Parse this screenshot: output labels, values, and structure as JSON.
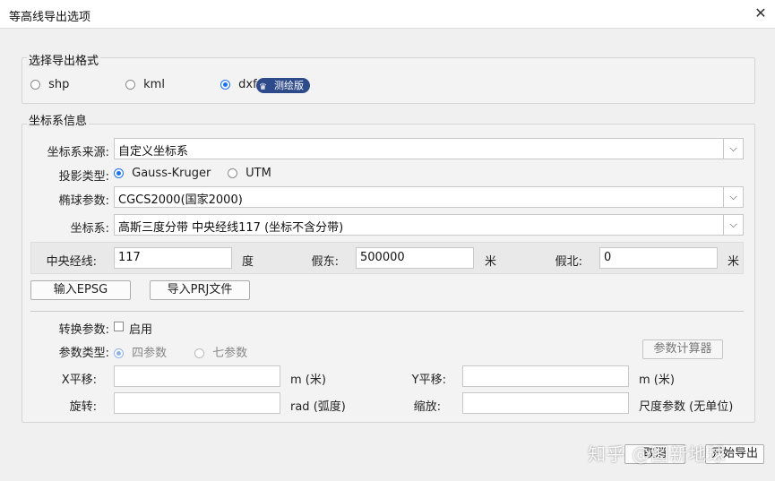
{
  "dialog": {
    "title": "等高线导出选项",
    "close_label": "✕"
  },
  "export_format": {
    "legend": "选择导出格式",
    "options": [
      {
        "label": "shp",
        "selected": false
      },
      {
        "label": "kml",
        "selected": false
      },
      {
        "label": "dxf",
        "selected": true
      }
    ],
    "badge": "测绘版"
  },
  "crs": {
    "legend": "坐标系信息",
    "source_label": "坐标系来源:",
    "source_value": "自定义坐标系",
    "projection_label": "投影类型:",
    "projection_options": [
      {
        "label": "Gauss-Kruger",
        "selected": true
      },
      {
        "label": "UTM",
        "selected": false
      }
    ],
    "ellipsoid_label": "椭球参数:",
    "ellipsoid_value": "CGCS2000(国家2000)",
    "system_label": "坐标系:",
    "system_value": "高斯三度分带 中央经线117 (坐标不含分带)",
    "central_meridian_label": "中央经线:",
    "central_meridian_value": "117",
    "central_meridian_unit": "度",
    "false_easting_label": "假东:",
    "false_easting_value": "500000",
    "false_easting_unit": "米",
    "false_northing_label": "假北:",
    "false_northing_value": "0",
    "false_northing_unit": "米",
    "input_epsg_button": "输入EPSG",
    "import_prj_button": "导入PRJ文件"
  },
  "transform": {
    "params_label": "转换参数:",
    "enable_label": "启用",
    "type_label": "参数类型:",
    "type_options": [
      {
        "label": "四参数",
        "selected": true
      },
      {
        "label": "七参数",
        "selected": false
      }
    ],
    "calculator_button": "参数计算器",
    "x_shift_label": "X平移:",
    "x_shift_unit": "m (米)",
    "y_shift_label": "Y平移:",
    "y_shift_unit": "m (米)",
    "rotation_label": "旋转:",
    "rotation_unit": "rad (弧度)",
    "scale_label": "缩放:",
    "scale_unit": "尺度参数 (无单位)"
  },
  "footer": {
    "cancel_button": "取消",
    "export_button": "开始导出"
  },
  "watermark": "知乎 @图新地球",
  "colors": {
    "accent": "#1a73e8",
    "badge": "#2d4a8a"
  }
}
